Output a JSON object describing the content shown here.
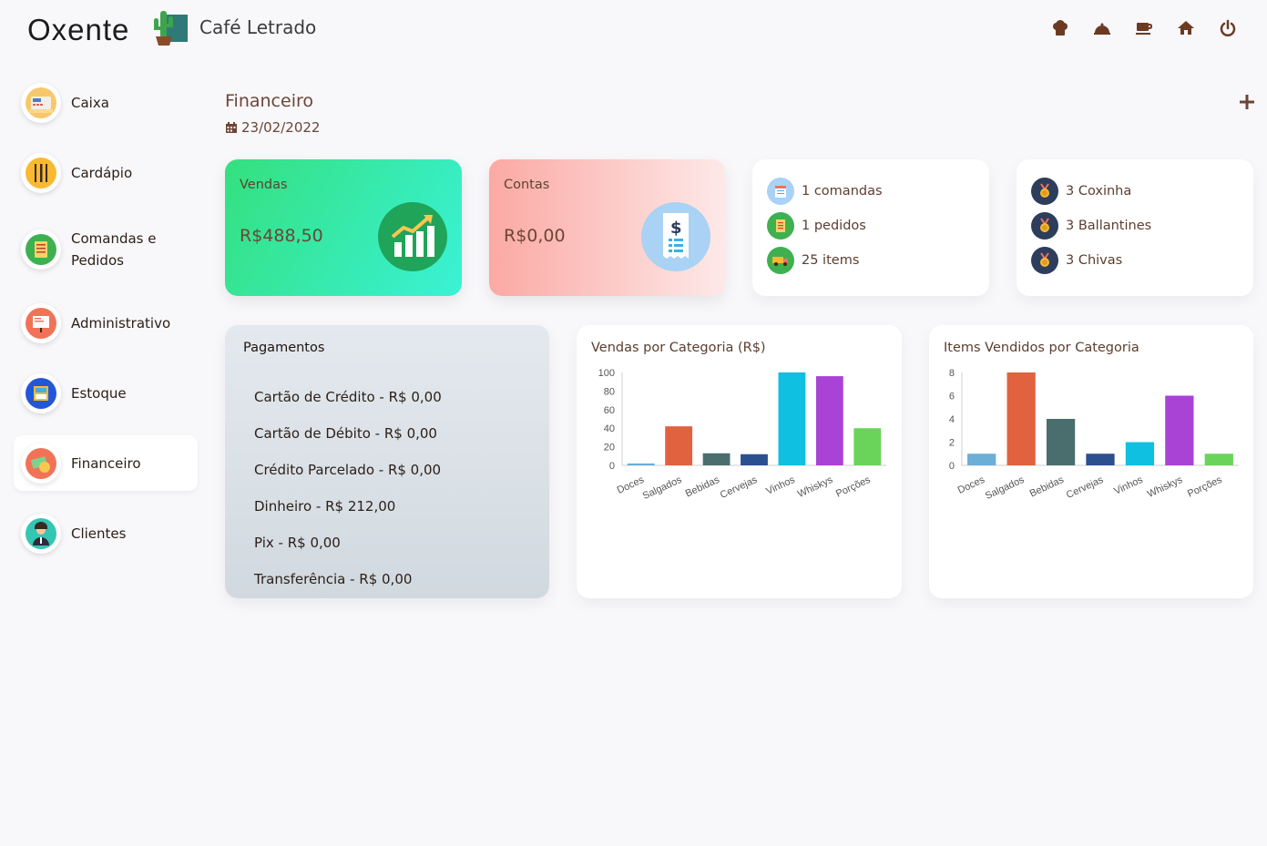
{
  "header": {
    "logo_text": "Oxente",
    "cafe_name": "Café Letrado",
    "icons": [
      "chef-hat-icon",
      "cloche-icon",
      "coffee-cup-icon",
      "home-icon",
      "power-icon"
    ]
  },
  "sidebar": {
    "items": [
      {
        "label": "Caixa",
        "icon": "cash-register-icon",
        "active": false
      },
      {
        "label": "Cardápio",
        "icon": "cutlery-icon",
        "active": false
      },
      {
        "label": "Comandas e Pedidos",
        "icon": "order-list-icon",
        "active": false
      },
      {
        "label": "Administrativo",
        "icon": "presentation-board-icon",
        "active": false
      },
      {
        "label": "Estoque",
        "icon": "storage-box-icon",
        "active": false
      },
      {
        "label": "Financeiro",
        "icon": "money-icon",
        "active": true
      },
      {
        "label": "Clientes",
        "icon": "customer-icon",
        "active": false
      }
    ]
  },
  "page": {
    "title": "Financeiro",
    "date": "23/02/2022"
  },
  "cards": {
    "vendas": {
      "label": "Vendas",
      "value": "R$488,50",
      "color": "#34e07e"
    },
    "contas": {
      "label": "Contas",
      "value": "R$0,00",
      "color": "#fba9a3"
    },
    "stats": [
      {
        "text": "1 comandas",
        "icon": "calendar-icon"
      },
      {
        "text": "1 pedidos",
        "icon": "order-icon"
      },
      {
        "text": "25 items",
        "icon": "delivery-truck-icon"
      }
    ],
    "top_items": [
      {
        "text": "3 Coxinha",
        "icon": "medal-icon"
      },
      {
        "text": "3 Ballantines",
        "icon": "medal-icon"
      },
      {
        "text": "3 Chivas",
        "icon": "medal-icon"
      }
    ]
  },
  "pagamentos": {
    "title": "Pagamentos",
    "items": [
      "Cartão de Crédito - R$ 0,00",
      "Cartão de Débito - R$ 0,00",
      "Crédito Parcelado - R$ 0,00",
      "Dinheiro - R$ 212,00",
      "Pix - R$ 0,00",
      "Transferência - R$ 0,00"
    ]
  },
  "chart_data": [
    {
      "type": "bar",
      "title": "Vendas por Categoria (R$)",
      "categories": [
        "Doces",
        "Salgados",
        "Bebidas",
        "Cervejas",
        "Vinhos",
        "Whiskys",
        "Porções"
      ],
      "values": [
        2,
        42,
        13,
        12,
        100,
        96,
        40
      ],
      "colors": [
        "#6baed6",
        "#e0623f",
        "#4a6e6e",
        "#2b4f8f",
        "#0fc0e0",
        "#a943d6",
        "#6ad45a"
      ],
      "yticks": [
        0,
        20,
        40,
        60,
        80,
        100
      ],
      "ylim": [
        0,
        100
      ],
      "xlabel": "",
      "ylabel": "",
      "grid": false
    },
    {
      "type": "bar",
      "title": "Items Vendidos por Categoria",
      "categories": [
        "Doces",
        "Salgados",
        "Bebidas",
        "Cervejas",
        "Vinhos",
        "Whiskys",
        "Porções"
      ],
      "values": [
        1,
        8,
        4,
        1,
        2,
        6,
        1
      ],
      "colors": [
        "#6baed6",
        "#e0623f",
        "#4a6e6e",
        "#2b4f8f",
        "#0fc0e0",
        "#a943d6",
        "#6ad45a"
      ],
      "yticks": [
        0,
        2,
        4,
        6,
        8
      ],
      "ylim": [
        0,
        8
      ],
      "xlabel": "",
      "ylabel": "",
      "grid": false
    }
  ]
}
